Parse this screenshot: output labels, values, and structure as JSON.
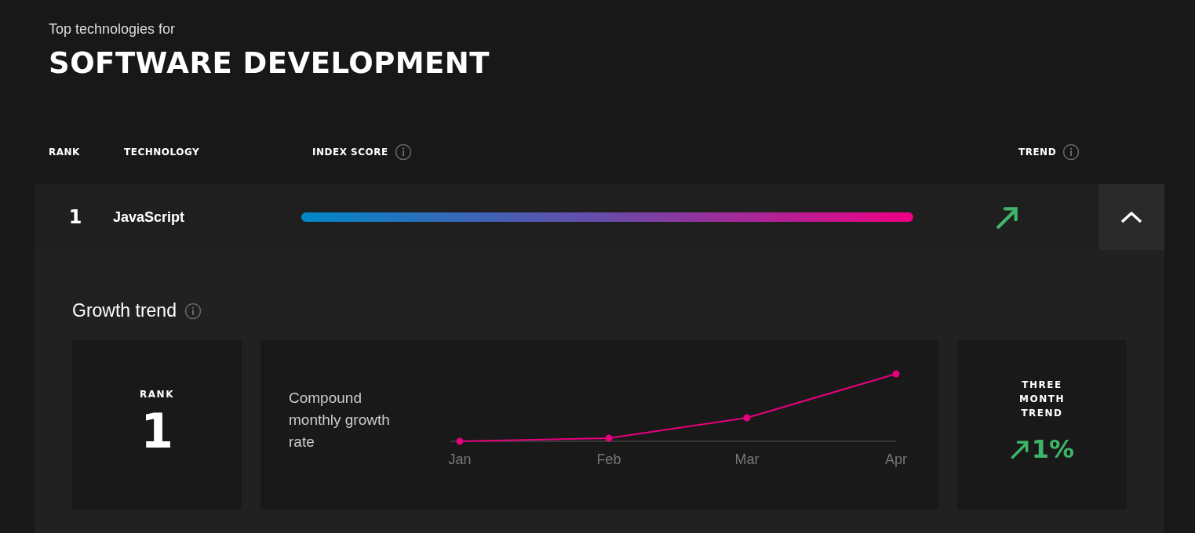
{
  "header": {
    "eyebrow": "Top technologies for",
    "title": "SOFTWARE DEVELOPMENT"
  },
  "table": {
    "columns": [
      {
        "label": "RANK",
        "info": false
      },
      {
        "label": "TECHNOLOGY",
        "info": false
      },
      {
        "label": "INDEX SCORE",
        "info": true
      },
      {
        "label": "TREND",
        "info": true
      }
    ],
    "rows": [
      {
        "rank": "1",
        "technology": "JavaScript",
        "rising": true,
        "expanded": true
      }
    ]
  },
  "detail": {
    "title": "Growth trend",
    "rank_label": "RANK",
    "rank": "1",
    "rate_label": "Compound monthly growth rate",
    "months": [
      "Jan",
      "Feb",
      "Mar",
      "Apr"
    ],
    "three_month_label": "THREE MONTH TREND",
    "three_month_rising": true,
    "three_month_value": "1%"
  }
}
